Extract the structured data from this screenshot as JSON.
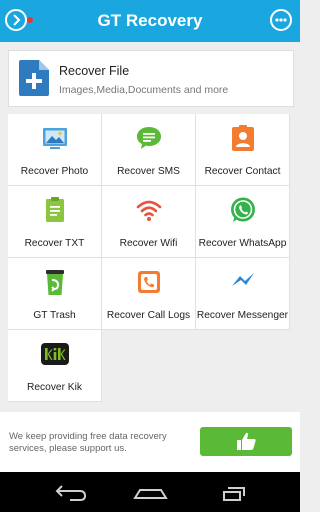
{
  "header": {
    "title": "GT Recovery"
  },
  "card": {
    "title": "Recover File",
    "subtitle": "Images,Media,Documents and more"
  },
  "grid": [
    {
      "label": "Recover Photo"
    },
    {
      "label": "Recover SMS"
    },
    {
      "label": "Recover Contact"
    },
    {
      "label": "Recover TXT"
    },
    {
      "label": "Recover Wifi"
    },
    {
      "label": "Recover WhatsApp"
    },
    {
      "label": "GT Trash"
    },
    {
      "label": "Recover Call Logs"
    },
    {
      "label": "Recover Messenger"
    },
    {
      "label": "Recover Kik"
    }
  ],
  "bottom": {
    "message": "We keep providing free data recovery services, please support us."
  },
  "colors": {
    "header_bg": "#1aa7df",
    "card_file_icon": "#2f7bbf",
    "support_button": "#5ab936",
    "notification_dot": "#e53935"
  }
}
